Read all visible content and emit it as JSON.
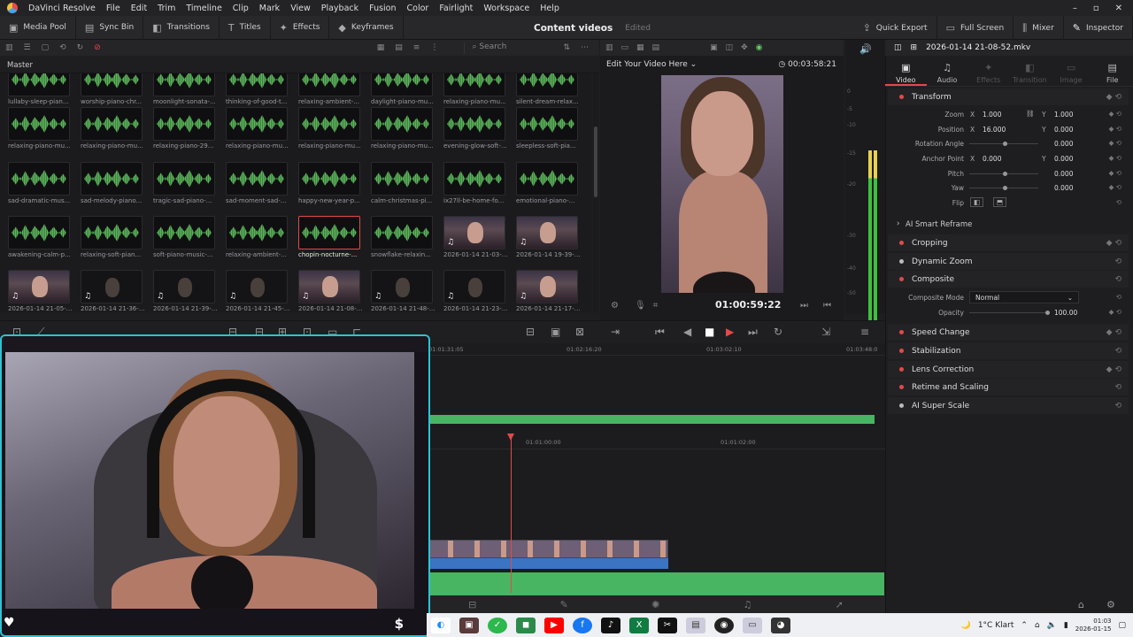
{
  "menu": {
    "app": "DaVinci Resolve",
    "items": [
      "File",
      "Edit",
      "Trim",
      "Timeline",
      "Clip",
      "Mark",
      "View",
      "Playback",
      "Fusion",
      "Color",
      "Fairlight",
      "Workspace",
      "Help"
    ]
  },
  "toolbar": {
    "media_pool": "Media Pool",
    "sync_bin": "Sync Bin",
    "transitions": "Transitions",
    "titles": "Titles",
    "effects": "Effects",
    "keyframes": "Keyframes",
    "project_title": "Content videos",
    "edited": "Edited",
    "quick_export": "Quick Export",
    "full_screen": "Full Screen",
    "mixer": "Mixer",
    "inspector": "Inspector"
  },
  "pool": {
    "search_placeholder": "Search",
    "bin": "Master"
  },
  "clips_row0": [
    "lullaby-sleep-pian...",
    "worship-piano-chr...",
    "moonlight-sonata-...",
    "thinking-of-good-t...",
    "relaxing-ambient-...",
    "daylight-piano-mu...",
    "relaxing-piano-mu...",
    "silent-dream-relax..."
  ],
  "clips_row1": [
    "relaxing-piano-mu...",
    "relaxing-piano-mu...",
    "relaxing-piano-29...",
    "relaxing-piano-mu...",
    "relaxing-piano-mu...",
    "relaxing-piano-mu...",
    "evening-glow-soft-...",
    "sleepless-soft-pia..."
  ],
  "clips_row2": [
    "sad-dramatic-mus...",
    "sad-melody-piano...",
    "tragic-sad-piano-...",
    "sad-moment-sad-...",
    "happy-new-year-p...",
    "calm-christmas-pi...",
    "ix27ll-be-home-fo...",
    "emotional-piano-..."
  ],
  "clips_row3": [
    "awakening-calm-p...",
    "relaxing-soft-pian...",
    "soft-piano-music-...",
    "relaxing-ambient-...",
    "chopin-nocturne-...",
    "snowflake-relaxin...",
    "2026-01-14 21-03-...",
    "2026-01-14 19-39-..."
  ],
  "clips_row4": [
    "2026-01-14 21-05-...",
    "2026-01-14 21-36-...",
    "2026-01-14 21-39-...",
    "2026-01-14 21-45-...",
    "2026-01-14 21-08-...",
    "2026-01-14 21-48-...",
    "2026-01-14 21-23-...",
    "2026-01-14 21-17-..."
  ],
  "viewer": {
    "dropdown": "Edit Your Video Here",
    "timecode_total": "00:03:58:21",
    "timecode": "01:00:59:22"
  },
  "meter_scale": [
    "0",
    "-5",
    "-10",
    "-15",
    "-20",
    "-30",
    "-40",
    "-50"
  ],
  "timeline": {
    "ruler_top": [
      "01:01:31:05",
      "01:02:16:20",
      "01:03:02:10",
      "01:03:48:0"
    ],
    "ruler_bottom": [
      "01:01:00:00",
      "01:01:02:00"
    ]
  },
  "inspector": {
    "clip_name": "2026-01-14 21-08-52.mkv",
    "tabs": [
      "Video",
      "Audio",
      "Effects",
      "Transition",
      "Image",
      "File"
    ],
    "transform": "Transform",
    "zoom": {
      "label": "Zoom",
      "x": "1.000",
      "y": "1.000"
    },
    "position": {
      "label": "Position",
      "x": "16.000",
      "y": "0.000"
    },
    "rotation": {
      "label": "Rotation Angle",
      "v": "0.000"
    },
    "anchor": {
      "label": "Anchor Point",
      "x": "0.000",
      "y": "0.000"
    },
    "pitch": {
      "label": "Pitch",
      "v": "0.000"
    },
    "yaw": {
      "label": "Yaw",
      "v": "0.000"
    },
    "flip": "Flip",
    "ai_reframe": "AI Smart Reframe",
    "cropping": "Cropping",
    "dynamic_zoom": "Dynamic Zoom",
    "composite": "Composite",
    "composite_mode": {
      "label": "Composite Mode",
      "value": "Normal"
    },
    "opacity": {
      "label": "Opacity",
      "v": "100.00",
      "level": 1.0
    },
    "speed_change": "Speed Change",
    "stabilization": "Stabilization",
    "lens_correction": "Lens Correction",
    "retime": "Retime and Scaling",
    "ai_super_scale": "AI Super Scale",
    "x_axis": "X",
    "y_axis": "Y"
  },
  "taskbar": {
    "weather": "1°C  Klart",
    "time": "01:03",
    "date": "2026-01-15"
  },
  "colors": {
    "accent": "#e24a4a",
    "audio": "#47b562",
    "overlay_border": "#2bc4d6"
  }
}
